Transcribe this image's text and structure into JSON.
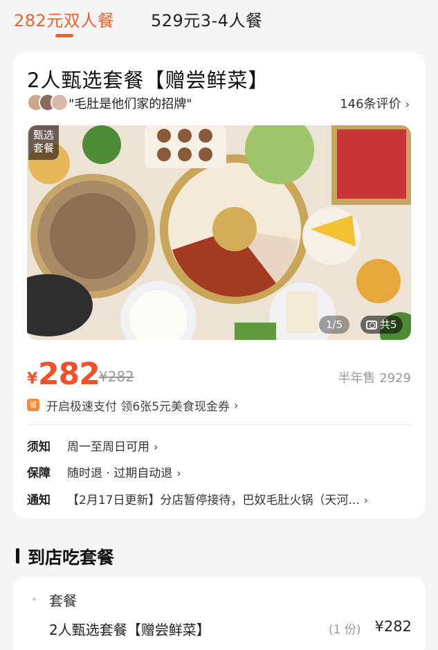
{
  "tabs": [
    {
      "label": "282元双人餐",
      "active": true
    },
    {
      "label": "529元3-4人餐",
      "active": false
    }
  ],
  "deal": {
    "title": "2人甄选套餐【赠尝鲜菜】",
    "review_quote": "\"毛肚是他们家的招牌\"",
    "review_count": "146条评价",
    "photo": {
      "badge": "甄选\n套餐",
      "counter": "1/5",
      "total": "共5"
    },
    "price": {
      "currency": "¥",
      "current": "282",
      "original": "¥282",
      "sold": "半年售 2929"
    },
    "promo": {
      "icon": "省",
      "text": "开启极速支付 领6张5元美食现金券"
    },
    "info": [
      {
        "key": "须知",
        "value": "周一至周日可用"
      },
      {
        "key": "保障",
        "value": "随时退 · 过期自动退"
      },
      {
        "key": "通知",
        "value": "【2月17日更新】分店暂停接待，巴奴毛肚火锅（天河..."
      }
    ]
  },
  "section": {
    "title": "到店吃套餐",
    "package_label": "套餐",
    "item": {
      "name": "2人甄选套餐【赠尝鲜菜】",
      "qty": "(1 份)",
      "price": "¥282"
    }
  },
  "colors": {
    "accent": "#f0622c",
    "price": "#f0502a",
    "background": "#f5f5f5"
  },
  "icons": [
    "chevron-right-icon",
    "camera-icon",
    "promo-save-icon"
  ]
}
